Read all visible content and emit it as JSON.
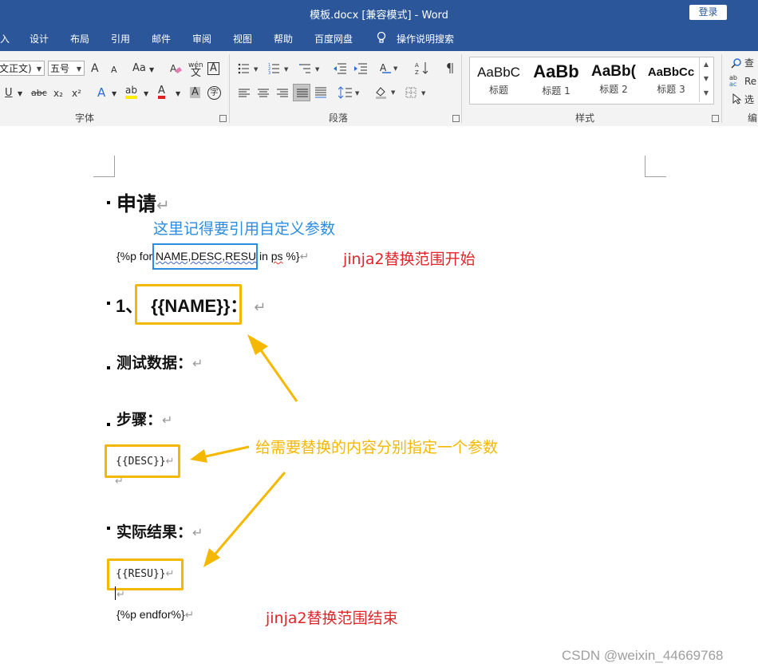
{
  "window": {
    "title": "模板.docx [兼容模式]  -  Word",
    "login_label": "登录"
  },
  "tabs": [
    "入",
    "设计",
    "布局",
    "引用",
    "邮件",
    "审阅",
    "视图",
    "帮助",
    "百度网盘",
    "操作说明搜索"
  ],
  "ribbon": {
    "font": {
      "font_name": "文正文)",
      "font_size": "五号",
      "group_label": "字体",
      "grow_font": "A",
      "shrink_font": "A",
      "change_case": "Aa",
      "phonetic": "wén",
      "char_border": "A",
      "underline": "U",
      "strike": "abc",
      "subscript": "x₂",
      "superscript": "x²",
      "text_effect": "A",
      "highlight": "ab",
      "font_color": "A",
      "char_shading": "A",
      "enclose": "字"
    },
    "paragraph": {
      "group_label": "段落"
    },
    "styles": {
      "group_label": "样式",
      "items": [
        {
          "preview": "AaBbC",
          "label": "标题"
        },
        {
          "preview": "AaBb",
          "label": "标题 1"
        },
        {
          "preview": "AaBb(",
          "label": "标题 2"
        },
        {
          "preview": "AaBbCc",
          "label": "标题 3"
        }
      ]
    },
    "editing": {
      "find": "查",
      "replace": "Re",
      "select": "选",
      "group_label": "编"
    }
  },
  "document": {
    "heading_apply": "申请",
    "for_prefix": "{%p for ",
    "for_vars": "NAME,DESC,RESU",
    "for_in": " in ",
    "for_ps": "ps",
    "for_suffix": " %}",
    "item_number": "1、",
    "name_var": "{{NAME}}",
    "item_suffix": "：",
    "test_data": "测试数据：",
    "steps": "步骤：",
    "desc_var": "{{DESC}}",
    "actual_result": "实际结果：",
    "resu_var": "{{RESU}}",
    "endfor": "{%p endfor%}",
    "return_mark": "↵"
  },
  "annotations": {
    "custom_param_note": "这里记得要引用自定义参数",
    "range_start": "jinja2替换范围开始",
    "assign_param": "给需要替换的内容分别指定一个参数",
    "range_end": "jinja2替换范围结束"
  },
  "watermark": "CSDN @weixin_44669768",
  "colors": {
    "title_bar": "#2b579a",
    "annotation_blue": "#2b8ce0",
    "annotation_red": "#e0262b",
    "annotation_yellow": "#f5b800"
  }
}
